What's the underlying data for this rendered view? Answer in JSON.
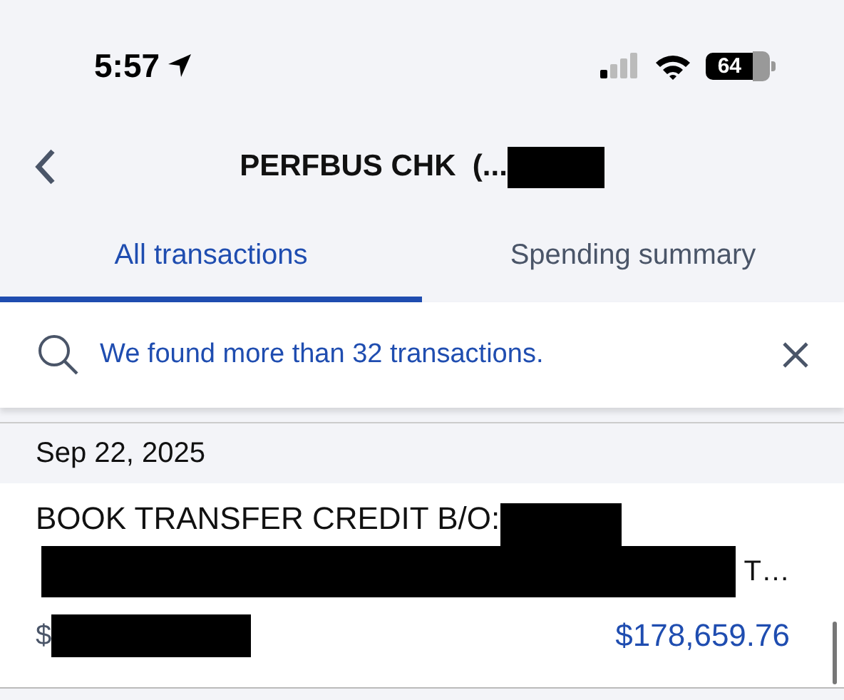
{
  "status_bar": {
    "time": "5:57",
    "battery": "64"
  },
  "header": {
    "title": "PERFBUS CHK  (..."
  },
  "tabs": [
    {
      "label": "All transactions",
      "selected": true
    },
    {
      "label": "Spending summary",
      "selected": false
    }
  ],
  "banner": {
    "message": "We found more than 32 transactions."
  },
  "groups": [
    {
      "date": "Sep 22, 2025",
      "transactions": [
        {
          "description_line1": "BOOK TRANSFER CREDIT B/O:",
          "description_line2_end": "T…",
          "balance_prefix": "$",
          "amount": "$178,659.76"
        }
      ]
    }
  ]
}
